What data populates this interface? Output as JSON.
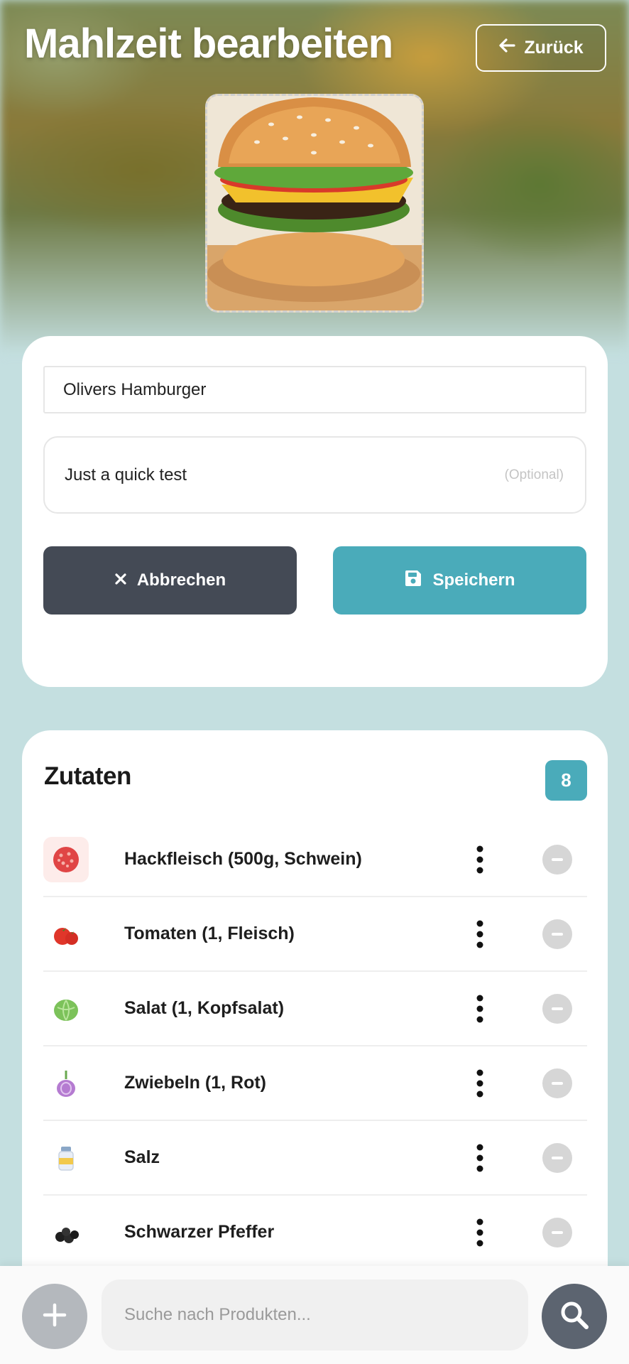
{
  "header": {
    "title": "Mahlzeit bearbeiten",
    "back_label": "Zurück"
  },
  "form": {
    "name_value": "Olivers Hamburger",
    "description_value": "Just a quick test",
    "description_hint": "(Optional)",
    "cancel_label": "Abbrechen",
    "save_label": "Speichern"
  },
  "ingredients": {
    "title": "Zutaten",
    "count": "8",
    "items": [
      {
        "label": "Hackfleisch (500g, Schwein)",
        "icon": "minced-meat-icon"
      },
      {
        "label": "Tomaten (1, Fleisch)",
        "icon": "tomato-icon"
      },
      {
        "label": "Salat (1, Kopfsalat)",
        "icon": "lettuce-icon"
      },
      {
        "label": "Zwiebeln (1, Rot)",
        "icon": "onion-icon"
      },
      {
        "label": "Salz",
        "icon": "salt-icon"
      },
      {
        "label": "Schwarzer Pfeffer",
        "icon": "pepper-icon"
      }
    ]
  },
  "search": {
    "placeholder": "Suche nach Produkten..."
  },
  "colors": {
    "accent": "#4aabba",
    "cancel": "#444a55",
    "background": "#c4dfe0"
  }
}
